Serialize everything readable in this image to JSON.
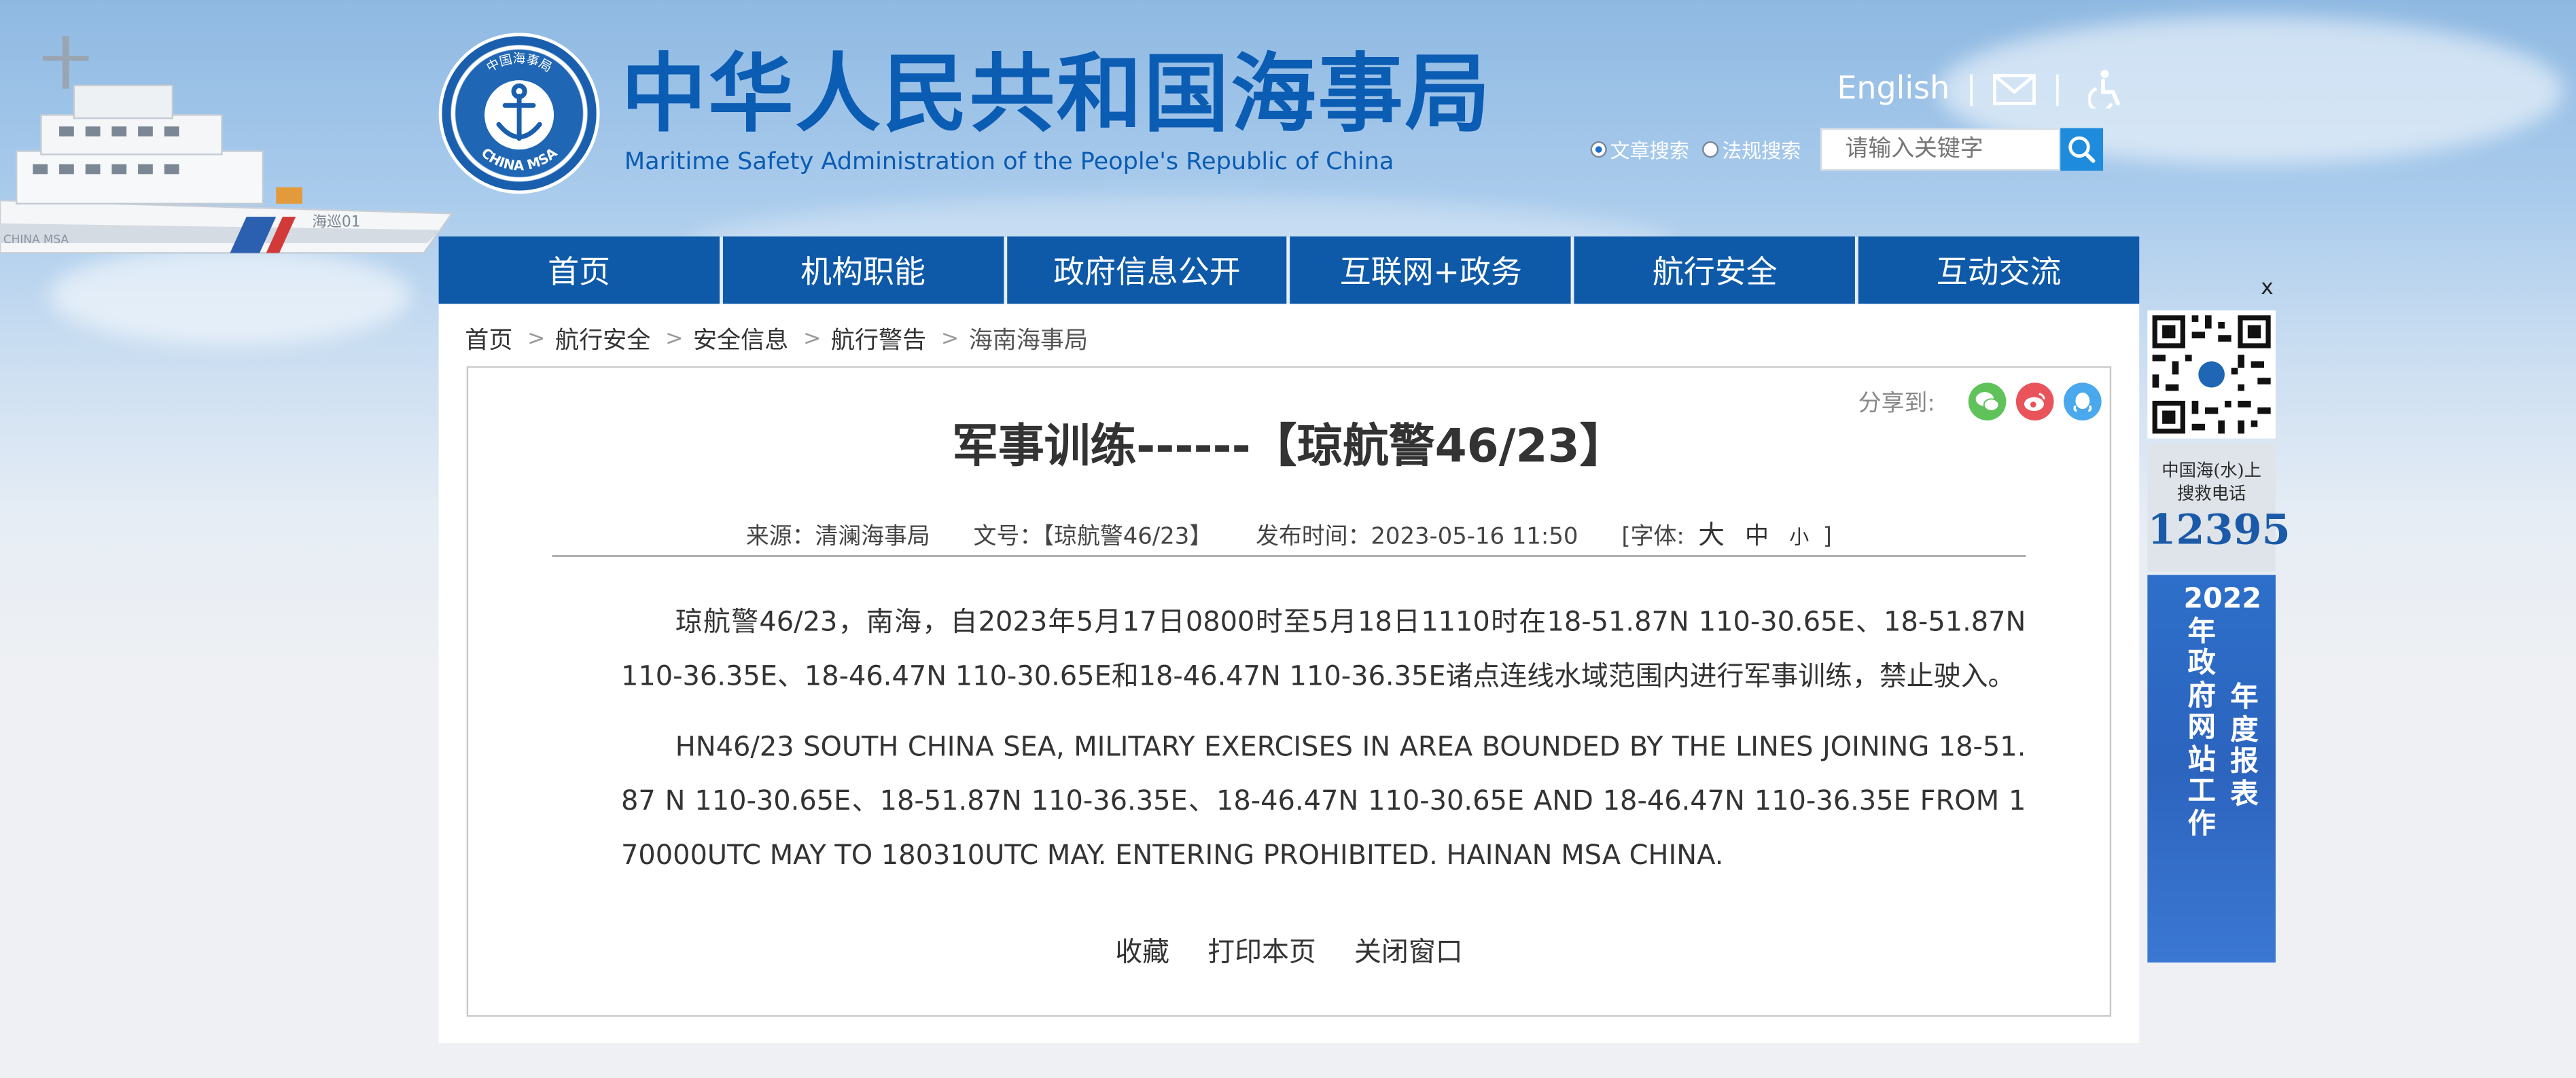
{
  "header": {
    "logo_cn": "中华人民共和国海事局",
    "logo_en": "Maritime Safety Administration of the People's Republic of China",
    "emblem_top": "中国海事局",
    "emblem_bottom": "CHINA MSA",
    "ship_hull_text": "海巡01",
    "ship_side_text": "CHINA MSA",
    "english_link": "English",
    "separator": "|"
  },
  "search": {
    "option_article": "文章搜索",
    "option_law": "法规搜索",
    "placeholder": "请输入关键字"
  },
  "nav": {
    "items": [
      "首页",
      "机构职能",
      "政府信息公开",
      "互联网+政务",
      "航行安全",
      "互动交流"
    ]
  },
  "breadcrumb": {
    "items": [
      "首页",
      "航行安全",
      "安全信息",
      "航行警告",
      "海南海事局"
    ],
    "separator": ">"
  },
  "article": {
    "share_label": "分享到:",
    "title": "军事训练------【琼航警46/23】",
    "meta": {
      "source": "来源：清澜海事局",
      "doc_no": "文号：【琼航警46/23】",
      "published": "发布时间：2023-05-16 11:50",
      "font_open": "[字体:",
      "font_large": "大",
      "font_medium": "中",
      "font_small": "小",
      "font_close": "]"
    },
    "paragraphs": [
      "琼航警46/23，南海，自2023年5月17日0800时至5月18日1110时在18-51.87N 110-30.65E、18-51.87N 110-36.35E、18-46.47N 110-30.65E和18-46.47N 110-36.35E诸点连线水域范围内进行军事训练，禁止驶入。",
      "HN46/23 SOUTH CHINA SEA, MILITARY EXERCISES IN AREA BOUNDED BY THE LINES JOINING 18-51.87 N 110-30.65E、18-51.87N 110-36.35E、18-46.47N 110-30.65E AND 18-46.47N 110-36.35E FROM 170000UTC MAY TO 180310UTC MAY. ENTERING PROHIBITED. HAINAN MSA CHINA."
    ],
    "actions": [
      "收藏",
      "打印本页",
      "关闭窗口"
    ]
  },
  "sidebar_float": {
    "close": "x",
    "hotline_text_1": "中国海(水)上",
    "hotline_text_2": "搜救电话",
    "hotline_number": "12395",
    "report_col_right": "年度报表",
    "report_col_left": "2022年政府网站工作"
  },
  "colors": {
    "nav_bg": "#0e5aa8",
    "brand_blue": "#0b5cb3",
    "search_button": "#1f8bdc",
    "wechat": "#5fc25a",
    "weibo": "#e8545a",
    "qq": "#4aa8ec"
  }
}
